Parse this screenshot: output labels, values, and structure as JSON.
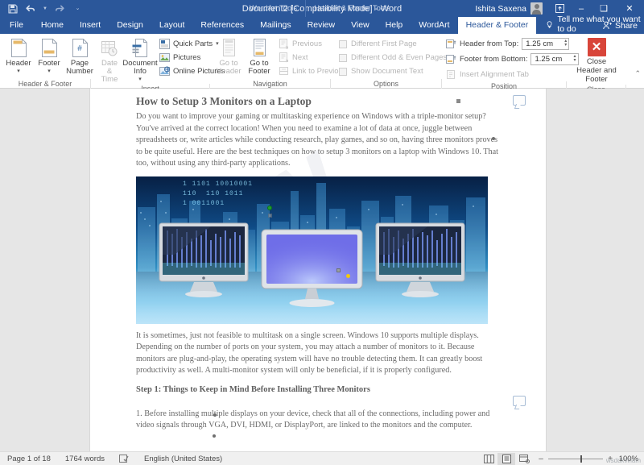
{
  "window": {
    "title": "Document2 [Compatibility Mode]  -  Word",
    "quick_access": [
      "save-icon",
      "undo-icon",
      "redo-icon",
      "customize-qat-icon"
    ],
    "context_tabs": [
      "WordArt Tools",
      "Header & Footer Tools"
    ],
    "user_name": "Ishita Saxena",
    "ribbon_display_options": "ribbon-display-icon",
    "minimize": "–",
    "maximize": "❑",
    "close": "✕"
  },
  "tabs": [
    {
      "label": "File",
      "active": false
    },
    {
      "label": "Home",
      "active": false
    },
    {
      "label": "Insert",
      "active": false
    },
    {
      "label": "Design",
      "active": false
    },
    {
      "label": "Layout",
      "active": false
    },
    {
      "label": "References",
      "active": false
    },
    {
      "label": "Mailings",
      "active": false
    },
    {
      "label": "Review",
      "active": false
    },
    {
      "label": "View",
      "active": false
    },
    {
      "label": "Help",
      "active": false
    },
    {
      "label": "WordArt",
      "active": false
    },
    {
      "label": "Header & Footer",
      "active": true
    }
  ],
  "tell_me": {
    "placeholder": "Tell me what you want to do"
  },
  "share": {
    "label": "Share"
  },
  "ribbon": {
    "groups": [
      {
        "label": "Header & Footer",
        "buttons": [
          {
            "label": "Header",
            "caret": true,
            "disabled": false
          },
          {
            "label": "Footer",
            "caret": true,
            "disabled": false
          },
          {
            "label": "Page Number",
            "caret": true,
            "disabled": false
          }
        ]
      },
      {
        "label": "Insert",
        "buttons": [
          {
            "label": "Date & Time",
            "caret": false,
            "disabled": true
          },
          {
            "label": "Document Info",
            "caret": true,
            "disabled": false
          }
        ],
        "small": [
          {
            "label": "Quick Parts",
            "caret": true,
            "disabled": false
          },
          {
            "label": "Pictures",
            "caret": false,
            "disabled": false
          },
          {
            "label": "Online Pictures",
            "caret": false,
            "disabled": false
          }
        ]
      },
      {
        "label": "Navigation",
        "buttons": [
          {
            "label": "Go to Header",
            "caret": false,
            "disabled": true
          },
          {
            "label": "Go to Footer",
            "caret": false,
            "disabled": false
          }
        ],
        "small": [
          {
            "label": "Previous",
            "caret": false,
            "disabled": true
          },
          {
            "label": "Next",
            "caret": false,
            "disabled": true
          },
          {
            "label": "Link to Previous",
            "caret": false,
            "disabled": true
          }
        ]
      },
      {
        "label": "Options",
        "checks": [
          {
            "label": "Different First Page",
            "checked": false
          },
          {
            "label": "Different Odd & Even Pages",
            "checked": false
          },
          {
            "label": "Show Document Text",
            "checked": false
          }
        ]
      },
      {
        "label": "Position",
        "rows": [
          {
            "label": "Header from Top:",
            "value": "1.25 cm",
            "disabled": false
          },
          {
            "label": "Footer from Bottom:",
            "value": "1.25 cm",
            "disabled": false
          },
          {
            "label": "Insert Alignment Tab",
            "value": "",
            "disabled": true
          }
        ]
      },
      {
        "label": "Close",
        "close_button": "Close Header and Footer"
      }
    ]
  },
  "document": {
    "heading1": "How to Setup 3 Monitors on a Laptop",
    "para1": "Do you want to improve your gaming or multitasking experience on Windows with a triple-monitor setup? You've arrived at the correct location! When you need to examine a lot of data at once, juggle between spreadsheets or, write articles while conducting research, play games, and so on, having three monitors proves to be quite useful. Here are the best techniques on how to setup 3 monitors on a laptop with Windows 10. That too, without using any third-party applications.",
    "figure_alt": "Three monitors on a desk with a night city skyline and binary code backdrop",
    "figure_binary": "1 1101 10010001\n110  110 1011\n1 0011001",
    "para2": "It is sometimes, just not feasible to multitask on a single screen. Windows 10 supports multiple displays. Depending on the number of ports on your system, you may attach a number of monitors to it. Because monitors are plug-and-play, the operating system will have no trouble detecting them. It can greatly boost productivity as well. A multi-monitor system will only be beneficial, if it is properly configured.",
    "heading2": "Step 1: Things to Keep in Mind Before Installing Three Monitors",
    "para3": "1. Before installing multiple displays on your device, check that all of the connections, including power and video signals through VGA, DVI, HDMI, or DisplayPort, are linked to the monitors and the computer.",
    "watermark_text": "W"
  },
  "status": {
    "page": "Page 1 of 18",
    "words": "1764 words",
    "proofing_icon": "spelling-check-icon",
    "language": "English (United States)",
    "views": [
      {
        "name": "read-mode-icon",
        "active": false
      },
      {
        "name": "print-layout-icon",
        "active": true
      },
      {
        "name": "web-layout-icon",
        "active": false
      }
    ],
    "zoom_minus": "–",
    "zoom_plus": "+",
    "zoom_level": "100%",
    "watermark": "wsddkWlam"
  },
  "colors": {
    "brand": "#2b579a",
    "close_red": "#d8453a",
    "page_bg": "#ffffff",
    "app_bg": "#e6e6e6"
  }
}
